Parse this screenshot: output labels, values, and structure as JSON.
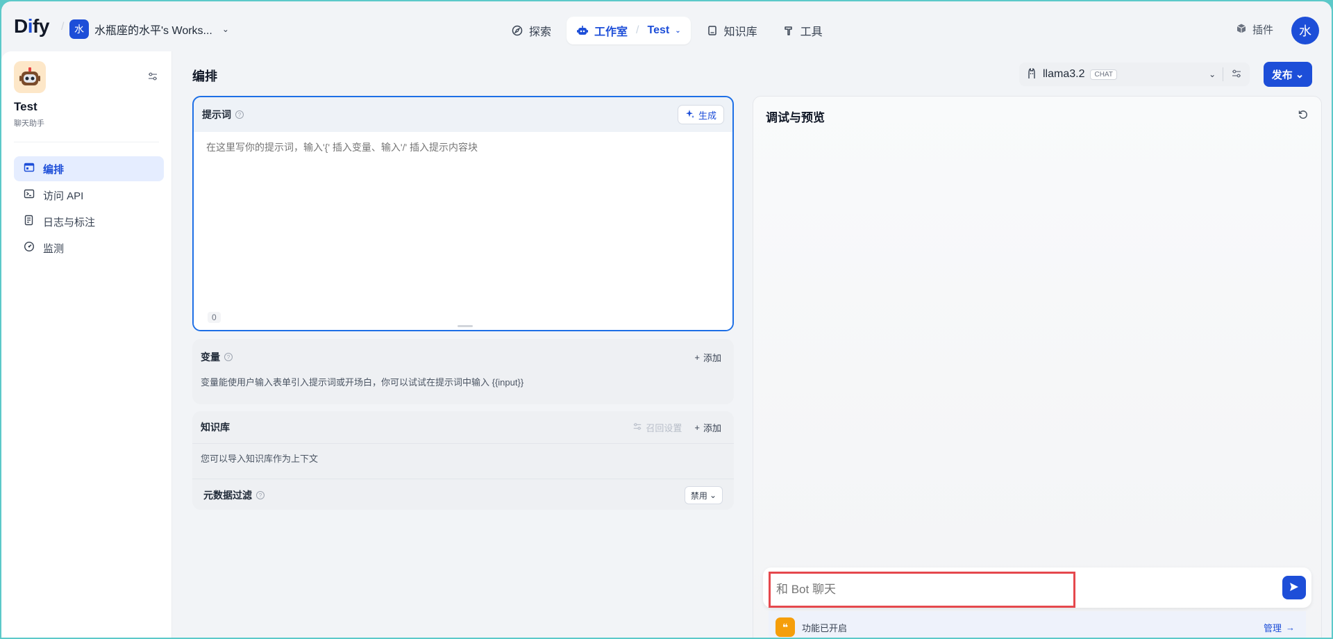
{
  "logo": {
    "part1": "D",
    "part2": "i",
    "part3": "fy"
  },
  "workspace": {
    "avatar": "水",
    "name": "水瓶座的水平's Works..."
  },
  "nav": {
    "explore": "探索",
    "studio": "工作室",
    "studio_sub": "Test",
    "knowledge": "知识库",
    "tools": "工具"
  },
  "header": {
    "plugins": "插件",
    "user_avatar": "水"
  },
  "app": {
    "name": "Test",
    "type": "聊天助手"
  },
  "sidebar": {
    "items": [
      {
        "label": "编排",
        "icon": "layout-icon"
      },
      {
        "label": "访问 API",
        "icon": "terminal-icon"
      },
      {
        "label": "日志与标注",
        "icon": "log-icon"
      },
      {
        "label": "监测",
        "icon": "gauge-icon"
      }
    ]
  },
  "main": {
    "title": "编排"
  },
  "model": {
    "name": "llama3.2",
    "tag": "CHAT"
  },
  "publish": {
    "label": "发布"
  },
  "prompt": {
    "title": "提示词",
    "generate": "生成",
    "placeholder": "在这里写你的提示词，输入'{' 插入变量、输入'/' 插入提示内容块",
    "count": "0"
  },
  "variables": {
    "title": "变量",
    "add": "添加",
    "desc": "变量能使用户输入表单引入提示词或开场白，你可以试试在提示词中输入 {{input}}"
  },
  "knowledge": {
    "title": "知识库",
    "recall": "召回设置",
    "add": "添加",
    "desc": "您可以导入知识库作为上下文",
    "meta_title": "元数据过滤",
    "meta_value": "禁用"
  },
  "debug": {
    "title": "调试与预览",
    "chat_placeholder": "和 Bot 聊天",
    "features": "功能已开启",
    "manage": "管理"
  },
  "colors": {
    "accent": "#1d4ed8",
    "highlight": "#e5484d",
    "feature": "#f59e0b"
  }
}
